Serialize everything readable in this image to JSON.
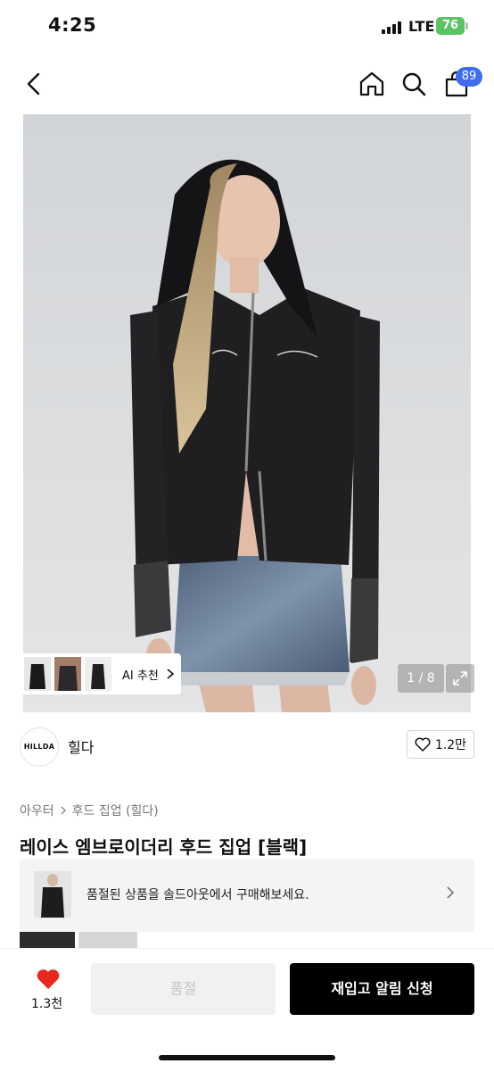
{
  "status_bar": {
    "time": "4:25",
    "network": "LTE",
    "battery": "76"
  },
  "header": {
    "cart_count": "89",
    "icons": [
      "back-arrow-icon",
      "home-icon",
      "search-icon",
      "cart-icon"
    ]
  },
  "gallery": {
    "counter": "1 / 8",
    "ai_recommend": "AI 추천"
  },
  "brand": {
    "logo_text": "HILLDA",
    "name": "힐다",
    "like_count": "1.2만"
  },
  "product": {
    "breadcrumb": [
      "아우터",
      "후드 집업 (힐다)"
    ],
    "title": "레이스 엠브로이더리 후드 집업 [블랙]"
  },
  "soldout_banner": {
    "text": "품절된 상품을 솔드아웃에서 구매해보세요."
  },
  "bottom_bar": {
    "like_count": "1.3천",
    "soldout_label": "품절",
    "restock_label": "재입고 알림 신청"
  },
  "colors": {
    "accent_badge": "#3e6df2",
    "heart": "#e8271f",
    "primary_button": "#000000"
  }
}
